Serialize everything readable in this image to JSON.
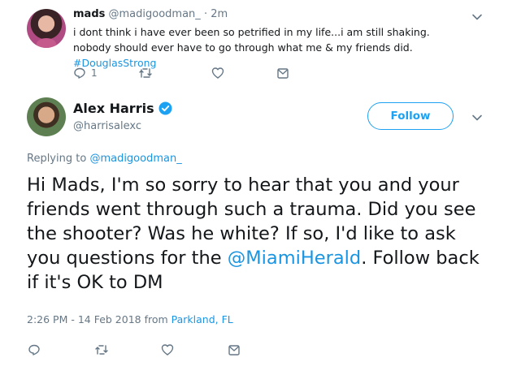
{
  "reply_tweet": {
    "name": "mads",
    "handle": "@madigoodman_",
    "separator": "·",
    "time": "2m",
    "text_before_hashtag": "i dont think i have ever been so petrified in my life...i am still shaking. nobody should ever have to go through what me & my friends did. ",
    "hashtag": "#DouglasStrong",
    "reply_count": "1"
  },
  "main_tweet": {
    "name": "Alex Harris",
    "handle": "@harrisalexc",
    "follow_label": "Follow",
    "replying_prefix": "Replying to ",
    "replying_mention": "@madigoodman_",
    "text_part1": "Hi Mads, I'm so sorry to hear that you and your friends went through such a trauma. Did you see the shooter? Was he white? If so, I'd like to ask you questions for the ",
    "text_mention": "@MiamiHerald",
    "text_part2": ". Follow back if it's OK to DM",
    "timestamp": "2:26 PM - 14 Feb 2018 from ",
    "location": "Parkland, FL"
  },
  "icons": [
    "reply-icon",
    "retweet-icon",
    "like-icon",
    "message-icon",
    "chevron-down-icon",
    "verified-icon"
  ],
  "colors": {
    "link": "#1b95e0",
    "follow": "#1da1f2",
    "muted": "#657786",
    "text": "#14171a"
  }
}
